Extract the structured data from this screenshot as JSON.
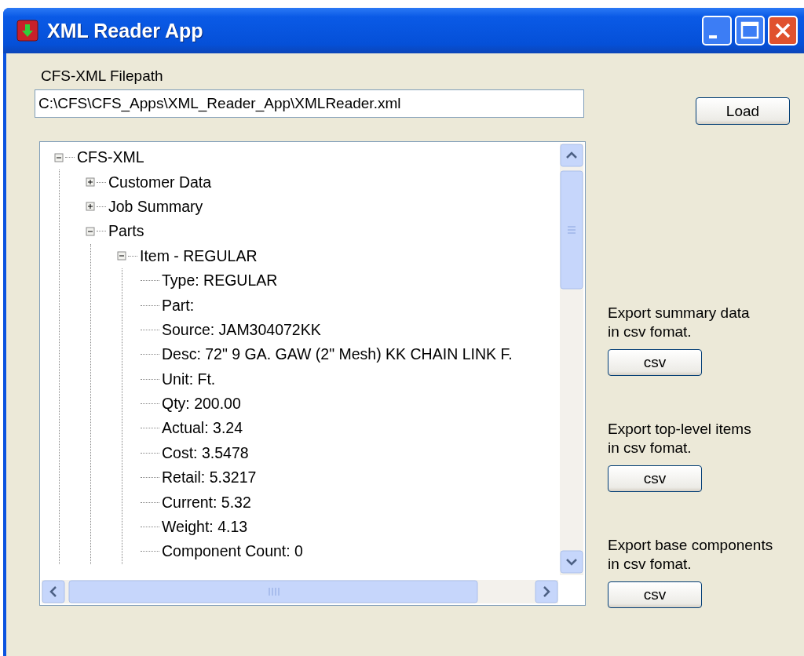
{
  "window": {
    "title": "XML Reader App"
  },
  "filepath": {
    "label": "CFS-XML Filepath",
    "value": "C:\\CFS\\CFS_Apps\\XML_Reader_App\\XMLReader.xml"
  },
  "load_button": "Load",
  "tree": [
    {
      "label": "CFS-XML",
      "expanded": true,
      "children": [
        {
          "label": "Customer Data",
          "expanded": false
        },
        {
          "label": "Job Summary",
          "expanded": false
        },
        {
          "label": "Parts",
          "expanded": true,
          "children": [
            {
              "label": "Item - REGULAR",
              "expanded": true,
              "children": [
                {
                  "label": "Type: REGULAR"
                },
                {
                  "label": "Part:"
                },
                {
                  "label": "Source: JAM304072KK"
                },
                {
                  "label": "Desc: 72\" 9 GA. GAW (2\" Mesh) KK CHAIN LINK F."
                },
                {
                  "label": "Unit: Ft."
                },
                {
                  "label": "Qty: 200.00"
                },
                {
                  "label": "Actual: 3.24"
                },
                {
                  "label": "Cost: 3.5478"
                },
                {
                  "label": "Retail: 5.3217"
                },
                {
                  "label": "Current: 5.32"
                },
                {
                  "label": "Weight: 4.13"
                },
                {
                  "label": "Component Count: 0"
                }
              ]
            }
          ]
        }
      ]
    }
  ],
  "exports": [
    {
      "text": "Export summary data\nin csv fomat.",
      "button": "csv"
    },
    {
      "text": "Export top-level items\nin csv fomat.",
      "button": "csv"
    },
    {
      "text": "Export base components\nin csv fomat.",
      "button": "csv"
    }
  ]
}
